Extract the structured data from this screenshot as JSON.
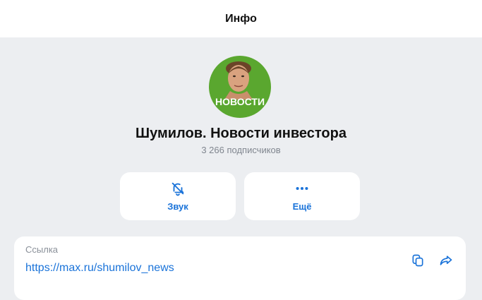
{
  "header": {
    "title": "Инфо"
  },
  "channel": {
    "avatar_text": "НОВОСТИ",
    "name": "Шумилов. Новости инвестора",
    "subscribers": "3 266 подписчиков"
  },
  "actions": [
    {
      "label": "Звук",
      "icon": "bell-off-icon"
    },
    {
      "label": "Ещё",
      "icon": "more-dots-icon"
    }
  ],
  "link_card": {
    "label": "Ссылка",
    "url": "https://max.ru/shumilov_news",
    "icons": [
      "copy-icon",
      "share-icon"
    ]
  },
  "colors": {
    "accent": "#1a73d9",
    "background": "#eceef1",
    "avatar_bg": "#5aa72f"
  }
}
